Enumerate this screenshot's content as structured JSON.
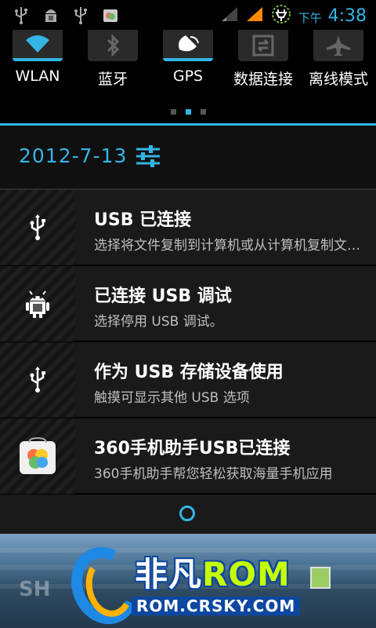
{
  "status_bar": {
    "ampm": "下午",
    "time": "4:38",
    "icons": [
      "usb-icon",
      "android-debug-icon",
      "usb-icon",
      "app-notification-icon",
      "signal-icon",
      "signal-icon",
      "charging-icon"
    ]
  },
  "toggles": [
    {
      "label": "WLAN",
      "icon": "wifi-icon",
      "on": true
    },
    {
      "label": "蓝牙",
      "icon": "bluetooth-icon",
      "on": false
    },
    {
      "label": "GPS",
      "icon": "gps-icon",
      "on": true
    },
    {
      "label": "数据连接",
      "icon": "data-connection-icon",
      "on": false
    },
    {
      "label": "离线模式",
      "icon": "airplane-icon",
      "on": false
    }
  ],
  "page_indicator": {
    "count": 3,
    "active": 2
  },
  "date": "2012-7-13",
  "notifications": [
    {
      "title": "USB 已连接",
      "text": "选择将文件复制到计算机或从计算机复制文件。",
      "icon": "usb-icon"
    },
    {
      "title": "已连接 USB 调试",
      "text": "选择停用 USB 调试。",
      "icon": "android-debug-icon"
    },
    {
      "title": "作为 USB 存储设备使用",
      "text": "触摸可显示其他 USB 选项",
      "icon": "usb-icon"
    },
    {
      "title": "360手机助手USB已连接",
      "text": "360手机助手帮您轻松获取海量手机应用",
      "icon": "app-360-icon"
    }
  ],
  "wallpaper": {
    "brand_part1": "非凡",
    "brand_part2": "ROM",
    "url": "ROM.CRSKY.COM",
    "partial_text": "SH"
  },
  "colors": {
    "accent": "#33b5e5",
    "background": "#000000",
    "panel": "#1a1a1a"
  }
}
